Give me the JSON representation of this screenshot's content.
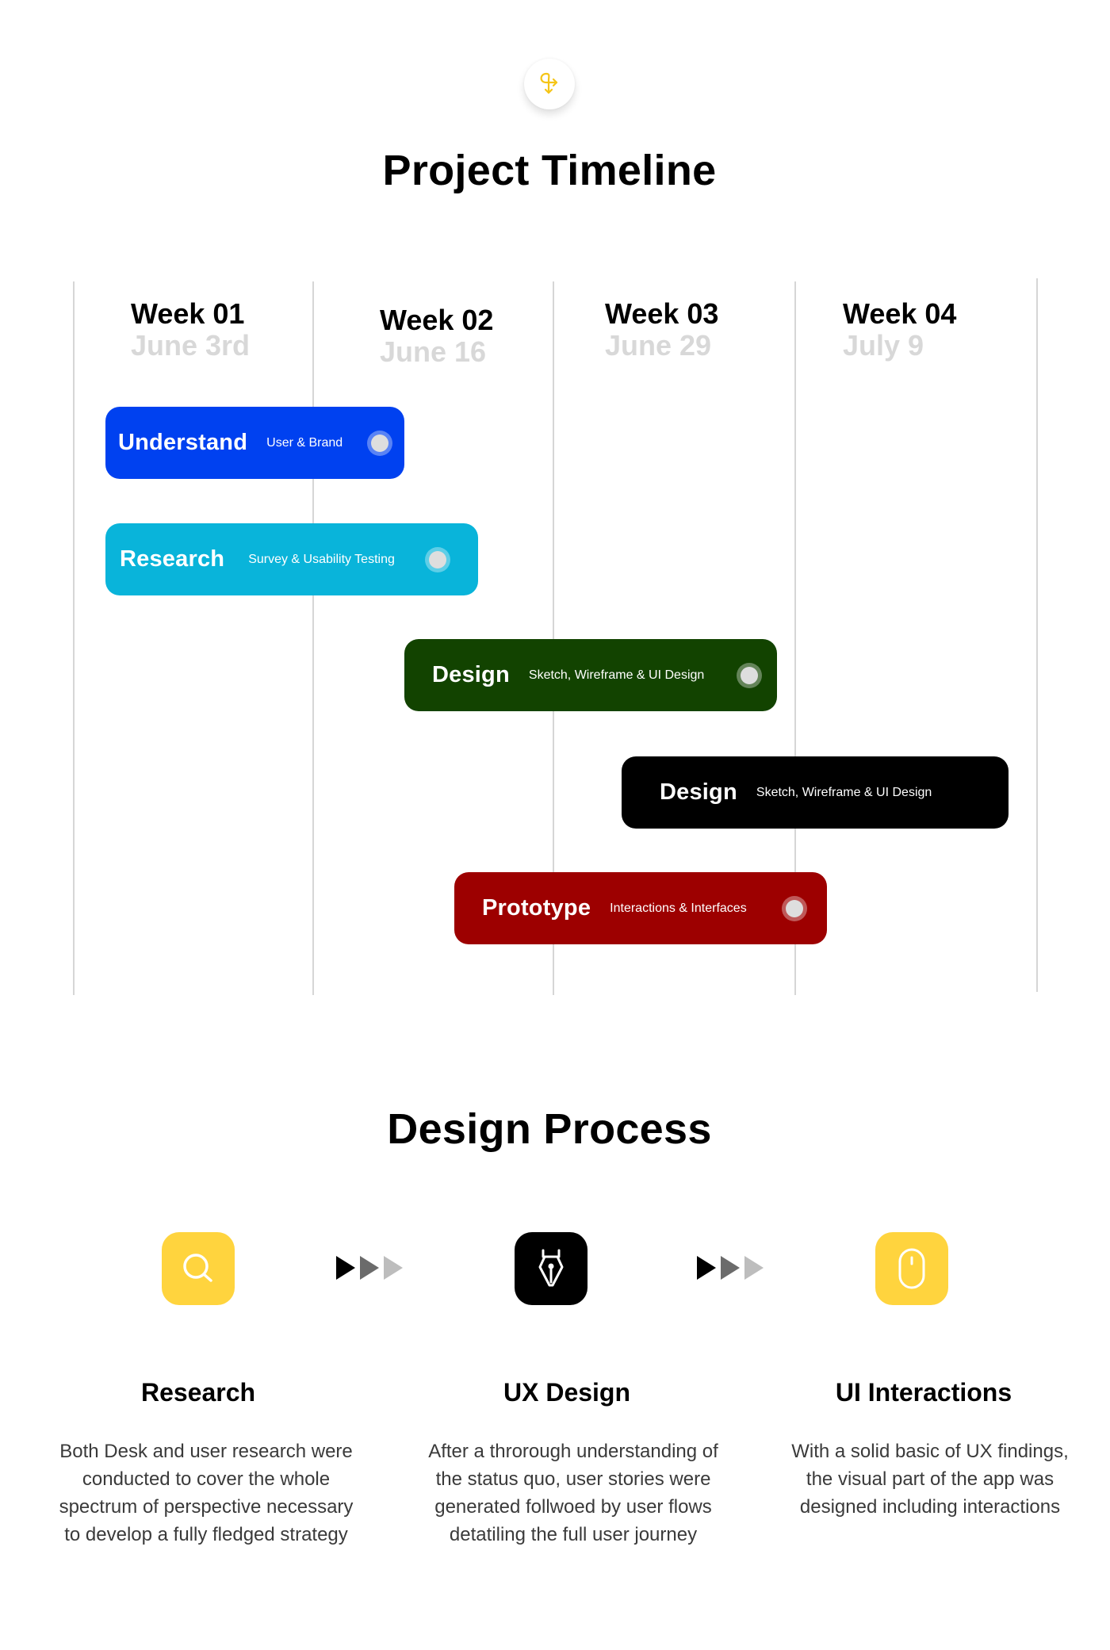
{
  "logo": {
    "icon": "split-arrows-icon",
    "color": "#F5C518"
  },
  "timeline": {
    "title": "Project Timeline",
    "weeks": [
      {
        "label": "Week 01",
        "date": "June 3rd"
      },
      {
        "label": "Week 02",
        "date": "June 16"
      },
      {
        "label": "Week 03",
        "date": "June 29"
      },
      {
        "label": "Week 04",
        "date": "July 9"
      }
    ],
    "tasks": [
      {
        "phase": "Understand",
        "detail": "User & Brand",
        "color": "#0041F0",
        "has_indicator": true
      },
      {
        "phase": "Research",
        "detail": "Survey & Usability Testing",
        "color": "#09B4DA",
        "has_indicator": true
      },
      {
        "phase": "Design",
        "detail": "Sketch, Wireframe & UI Design",
        "color": "#124300",
        "has_indicator": true
      },
      {
        "phase": "Design",
        "detail": "Sketch, Wireframe & UI Design",
        "color": "#000000",
        "has_indicator": false
      },
      {
        "phase": "Prototype",
        "detail": "Interactions & Interfaces",
        "color": "#9D0000",
        "has_indicator": true
      }
    ]
  },
  "process": {
    "title": "Design Process",
    "steps": [
      {
        "icon": "search-icon",
        "icon_bg": "#FFD43E",
        "title": "Research",
        "lines": [
          "Both Desk and user research were",
          "conducted to cover the whole",
          "spectrum of perspective necessary",
          "to develop a fully fledged strategy"
        ]
      },
      {
        "icon": "pen-nib-icon",
        "icon_bg": "#000000",
        "title": "UX Design",
        "lines": [
          "After a throrough understanding of",
          "the status quo, user stories were",
          "generated follwoed by user flows",
          "detatiling the full user journey"
        ]
      },
      {
        "icon": "mouse-icon",
        "icon_bg": "#FFD43E",
        "title": "UI Interactions",
        "lines": [
          "With a solid basic of UX findings,",
          "the visual part of the app was",
          "designed including interactions"
        ]
      }
    ],
    "arrow_colors": [
      "#000000",
      "#6B6B6B",
      "#BDBDBD"
    ]
  }
}
